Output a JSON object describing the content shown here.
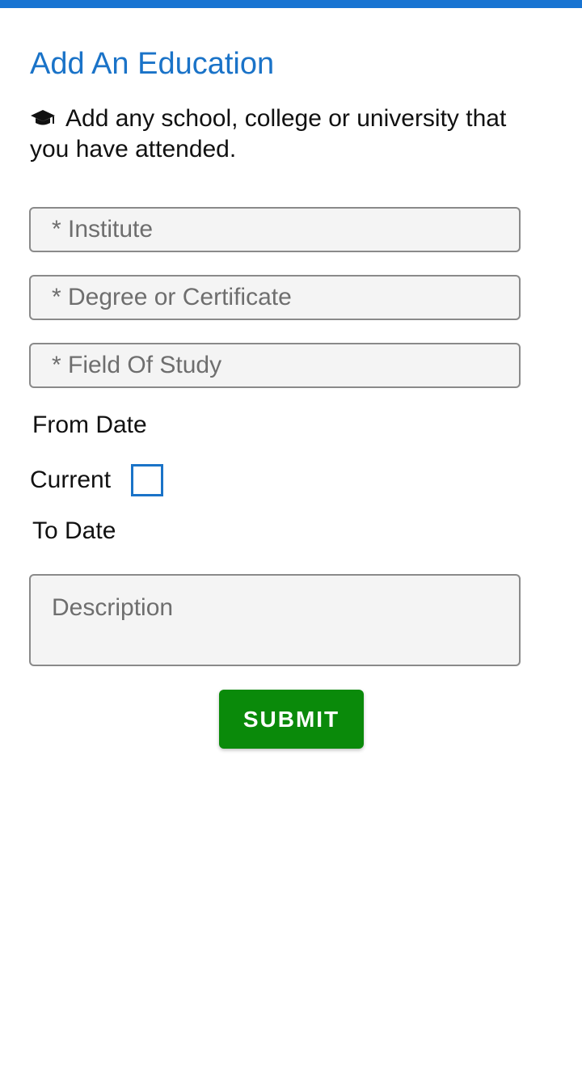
{
  "colors": {
    "accent": "#1a73c8",
    "top_bar": "#1874d2",
    "submit_bg": "#0a8a0a",
    "field_bg": "#f4f4f4"
  },
  "header": {
    "title": "Add An Education"
  },
  "intro": {
    "icon": "graduation-cap-icon",
    "text": "Add any school, college or university that you have attended."
  },
  "form": {
    "institute_placeholder": "* Institute",
    "degree_placeholder": "* Degree or Certificate",
    "field_of_study_placeholder": "* Field Of Study",
    "from_date_label": "From Date",
    "current_label": "Current",
    "current_checked": false,
    "to_date_label": "To Date",
    "description_placeholder": "Description",
    "submit_label": "SUBMIT"
  }
}
